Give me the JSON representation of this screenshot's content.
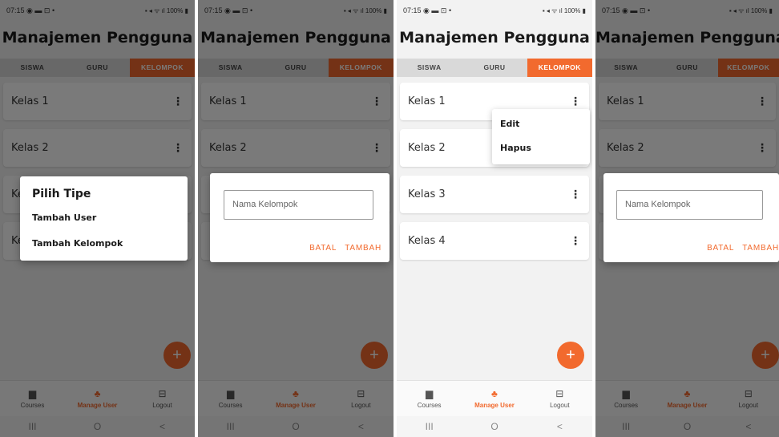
{
  "status": {
    "time": "07:15",
    "notif_icons": "◉ ▬ ⊡ •",
    "battery": "100%"
  },
  "app_title": "Manajemen Pengguna",
  "tabs": [
    "SISWA",
    "GURU",
    "KELOMPOK"
  ],
  "active_tab": "KELOMPOK",
  "groups": [
    "Kelas 1",
    "Kelas 2",
    "Kelas 3",
    "Kelas 4"
  ],
  "fab_label": "+",
  "bottom_nav": [
    {
      "label": "Courses",
      "icon": "book-icon"
    },
    {
      "label": "Manage User",
      "icon": "users-icon"
    },
    {
      "label": "Logout",
      "icon": "logout-icon"
    }
  ],
  "system_nav": [
    "III",
    "O",
    "<"
  ],
  "type_dialog": {
    "title": "Pilih Tipe",
    "options": [
      "Tambah User",
      "Tambah Kelompok"
    ]
  },
  "group_dialog": {
    "placeholder": "Nama Kelompok",
    "cancel": "BATAL",
    "confirm": "TAMBAH"
  },
  "context_menu": {
    "items": [
      "Edit",
      "Hapus"
    ]
  },
  "colors": {
    "accent": "#f26a2e",
    "overlay": "rgba(0,0,0,0.52)"
  }
}
